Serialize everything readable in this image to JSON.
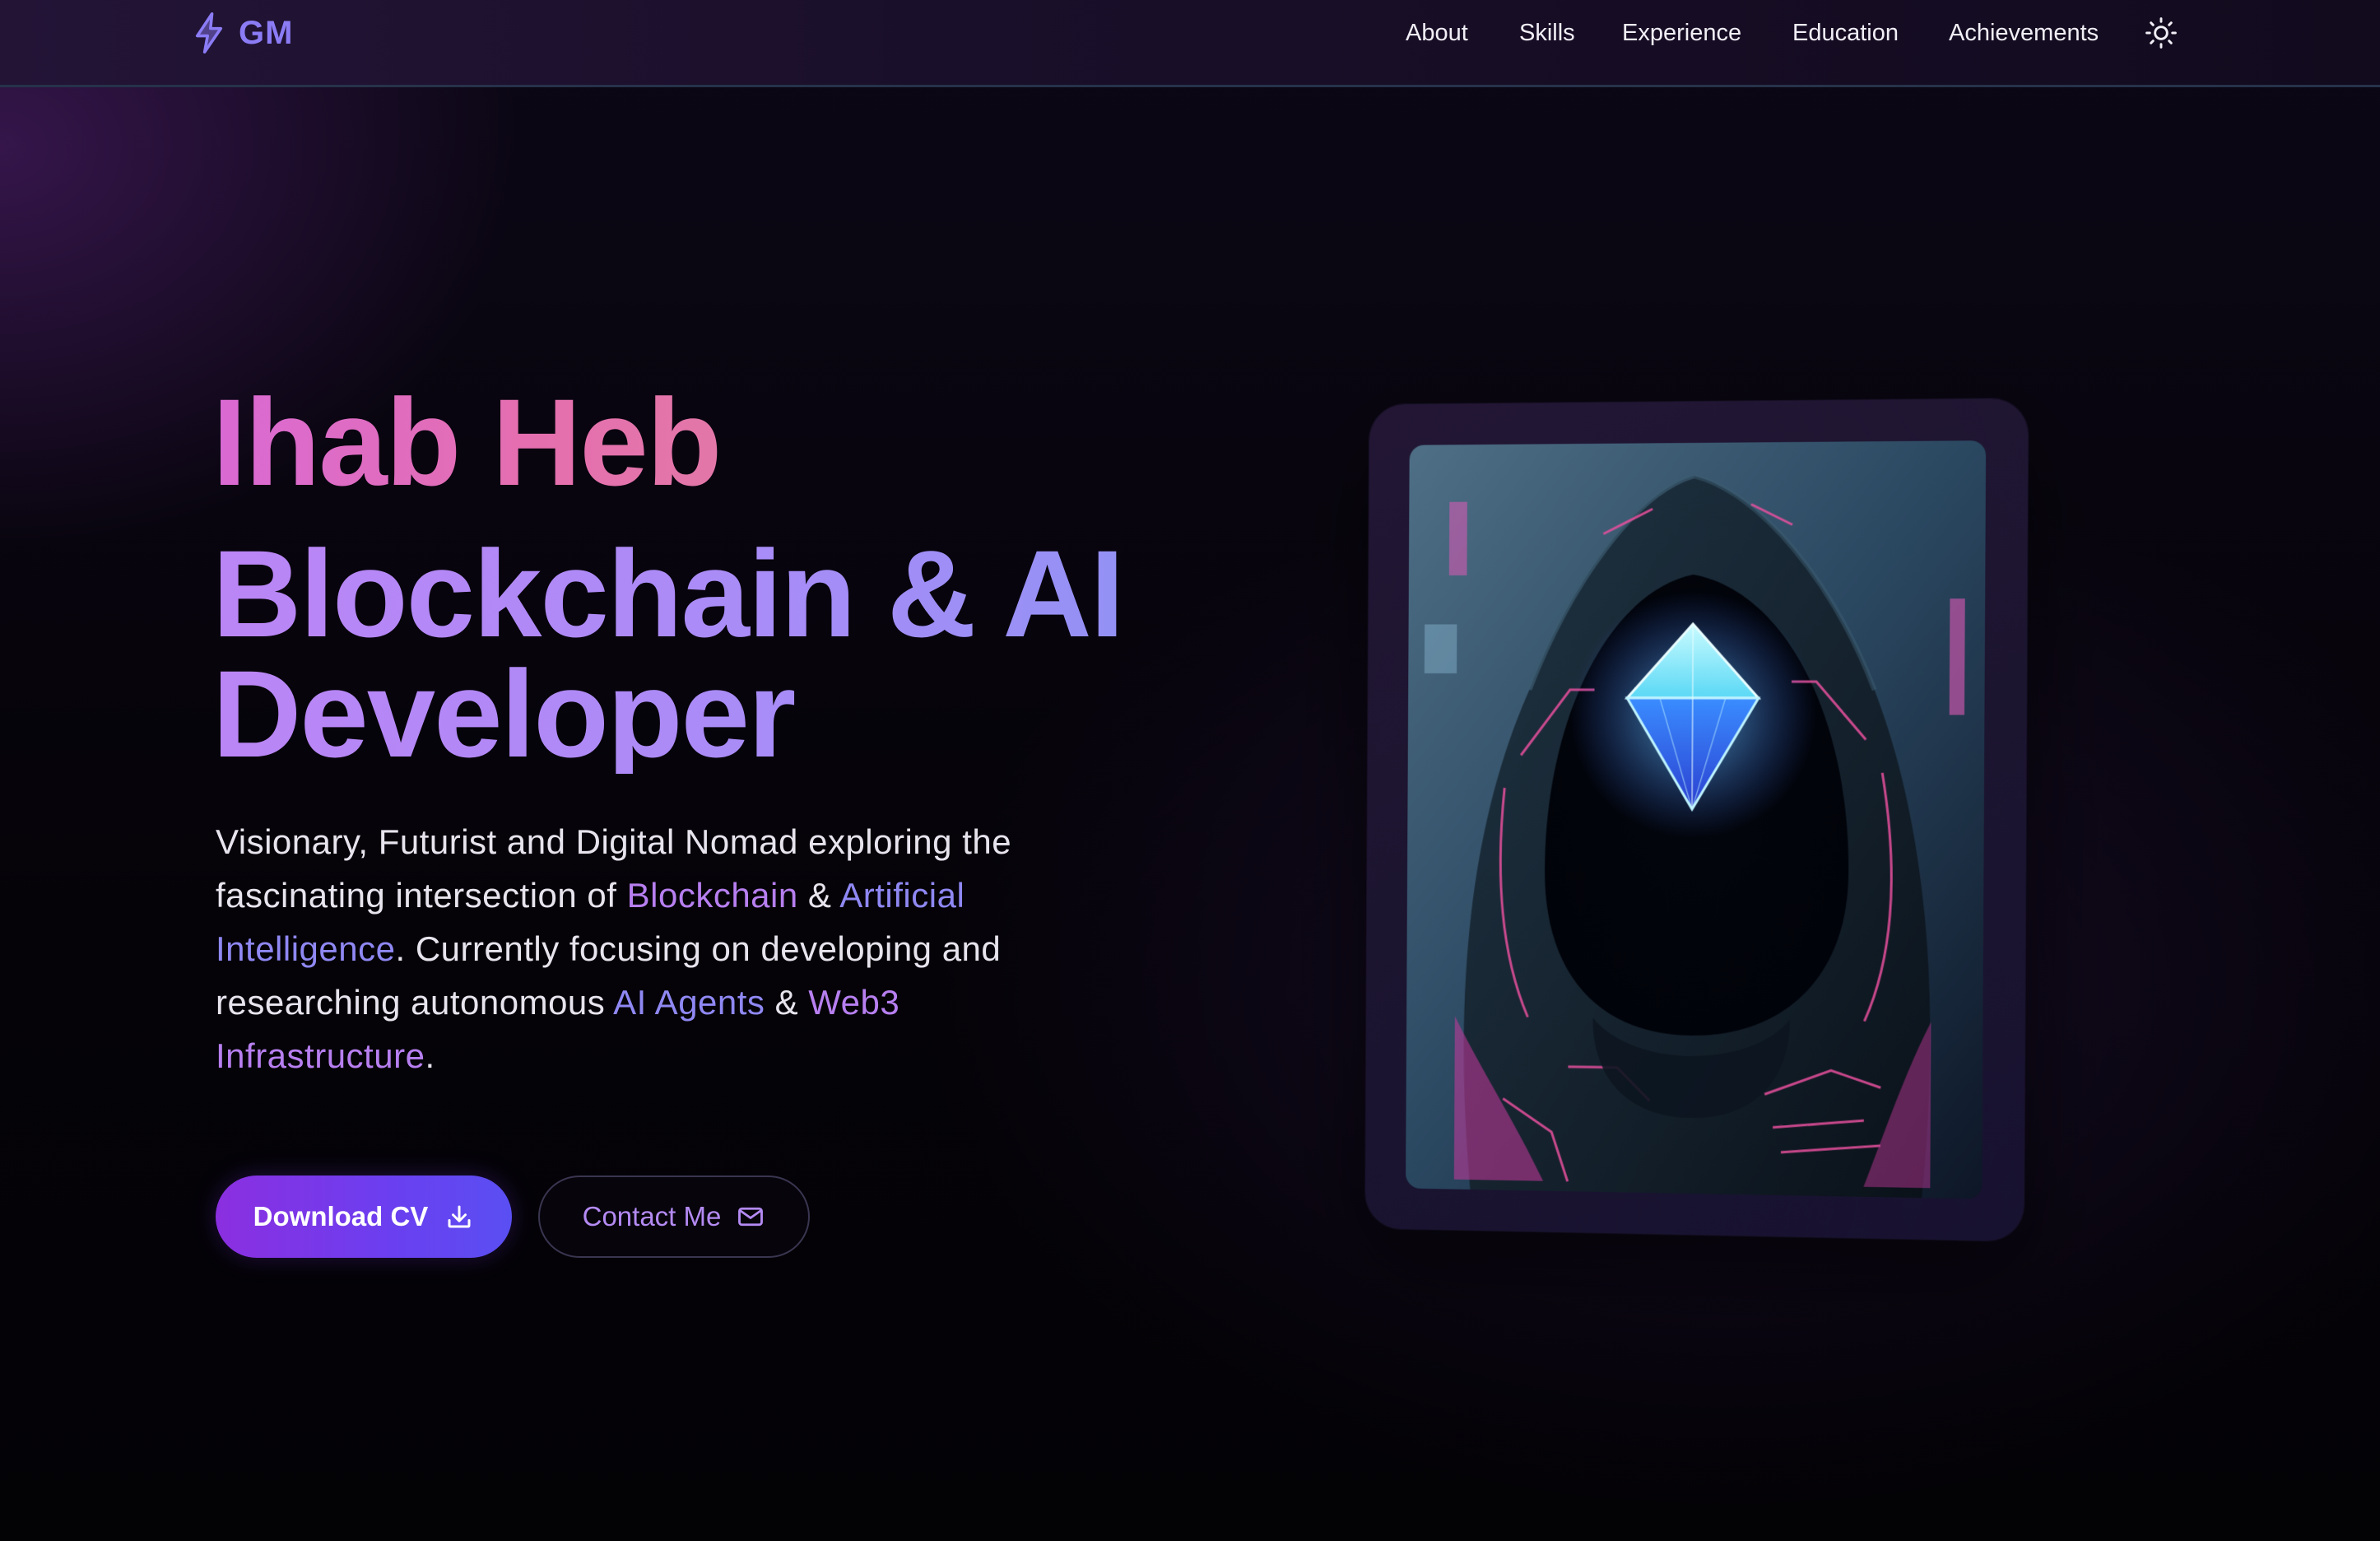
{
  "brand": {
    "logo_icon": "lightning-bolt-icon",
    "text": "GM",
    "accent": "#8b7cf6"
  },
  "nav": {
    "items": [
      {
        "label": "About"
      },
      {
        "label": "Skills"
      },
      {
        "label": "Experience"
      },
      {
        "label": "Education"
      },
      {
        "label": "Achievements"
      }
    ],
    "theme_toggle_icon": "sun-icon"
  },
  "hero": {
    "name": "Ihab Heb",
    "role_line1": "Blockchain & AI",
    "role_line2": "Developer",
    "description": {
      "p1": "Visionary, Futurist and Digital Nomad exploring the fascinating intersection of ",
      "hl1": "Blockchain",
      "p2": " & ",
      "hl2": "Artificial Intelligence",
      "p3": ". Currently focusing on developing and researching autonomous ",
      "hl3": "AI Agents",
      "p4": " & ",
      "hl4": "Web3 Infrastructure",
      "p5": "."
    },
    "primary_button": {
      "label": "Download CV",
      "icon": "download-icon"
    },
    "secondary_button": {
      "label": "Contact Me",
      "icon": "mail-icon"
    },
    "portrait": {
      "subject": "hooded-figure-diamond-portrait"
    }
  },
  "colors": {
    "name_gradient_start": "#d96ad4",
    "name_gradient_end": "#e377a8",
    "role_gradient_start": "#bb85f5",
    "role_gradient_end": "#8f92f4",
    "highlight_purple": "#b77ff0",
    "highlight_blue": "#8f88f3",
    "primary_button": "#7a35e8"
  }
}
